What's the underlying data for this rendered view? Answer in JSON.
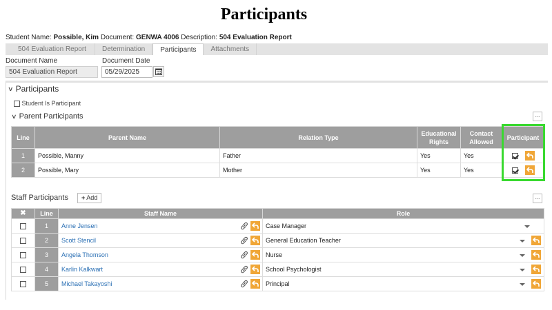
{
  "page": {
    "title": "Participants"
  },
  "info": {
    "student_label": "Student Name:",
    "student_value": "Possible, Kim",
    "document_label": "Document:",
    "document_value": "GENWA 4006",
    "description_label": "Description:",
    "description_value": "504 Evaluation Report"
  },
  "tabs": [
    {
      "label": "504 Evaluation Report",
      "active": false
    },
    {
      "label": "Determination",
      "active": false
    },
    {
      "label": "Participants",
      "active": true
    },
    {
      "label": "Attachments",
      "active": false
    }
  ],
  "form": {
    "document_name_label": "Document Name",
    "document_name_value": "504 Evaluation Report",
    "document_date_label": "Document Date",
    "document_date_value": "05/29/2025"
  },
  "participants_section": {
    "title": "Participants",
    "student_is_participant_label": "Student Is Participant",
    "student_is_participant_checked": false
  },
  "parent_section": {
    "title": "Parent Participants",
    "ellipsis_label": "...",
    "columns": {
      "line": "Line",
      "parent_name": "Parent Name",
      "relation_type": "Relation Type",
      "educational_rights_1": "Educational",
      "educational_rights_2": "Rights",
      "contact_allowed_1": "Contact",
      "contact_allowed_2": "Allowed",
      "participant": "Participant"
    },
    "rows": [
      {
        "line": "1",
        "name": "Possible, Manny",
        "relation": "Father",
        "educational_rights": "Yes",
        "contact_allowed": "Yes",
        "participant": true
      },
      {
        "line": "2",
        "name": "Possible, Mary",
        "relation": "Mother",
        "educational_rights": "Yes",
        "contact_allowed": "Yes",
        "participant": true
      }
    ]
  },
  "staff_section": {
    "title": "Staff Participants",
    "add_label": "Add",
    "ellipsis_label": "...",
    "columns": {
      "select": "✖",
      "line": "Line",
      "staff_name": "Staff Name",
      "role": "Role"
    },
    "rows": [
      {
        "line": "1",
        "name": "Anne Jensen",
        "role": "Case Manager",
        "role_reset": false
      },
      {
        "line": "2",
        "name": "Scott Stencil",
        "role": "General Education Teacher",
        "role_reset": true
      },
      {
        "line": "3",
        "name": "Angela Thomson",
        "role": "Nurse",
        "role_reset": true
      },
      {
        "line": "4",
        "name": "Karlin Kalkwart",
        "role": "School Psychologist",
        "role_reset": true
      },
      {
        "line": "5",
        "name": "Michael Takayoshi",
        "role": "Principal",
        "role_reset": true
      }
    ]
  },
  "colors": {
    "accent_orange": "#f0a637",
    "header_gray": "#9e9e9e",
    "highlight_green": "#39d92f",
    "link_blue": "#2a6fb4"
  }
}
